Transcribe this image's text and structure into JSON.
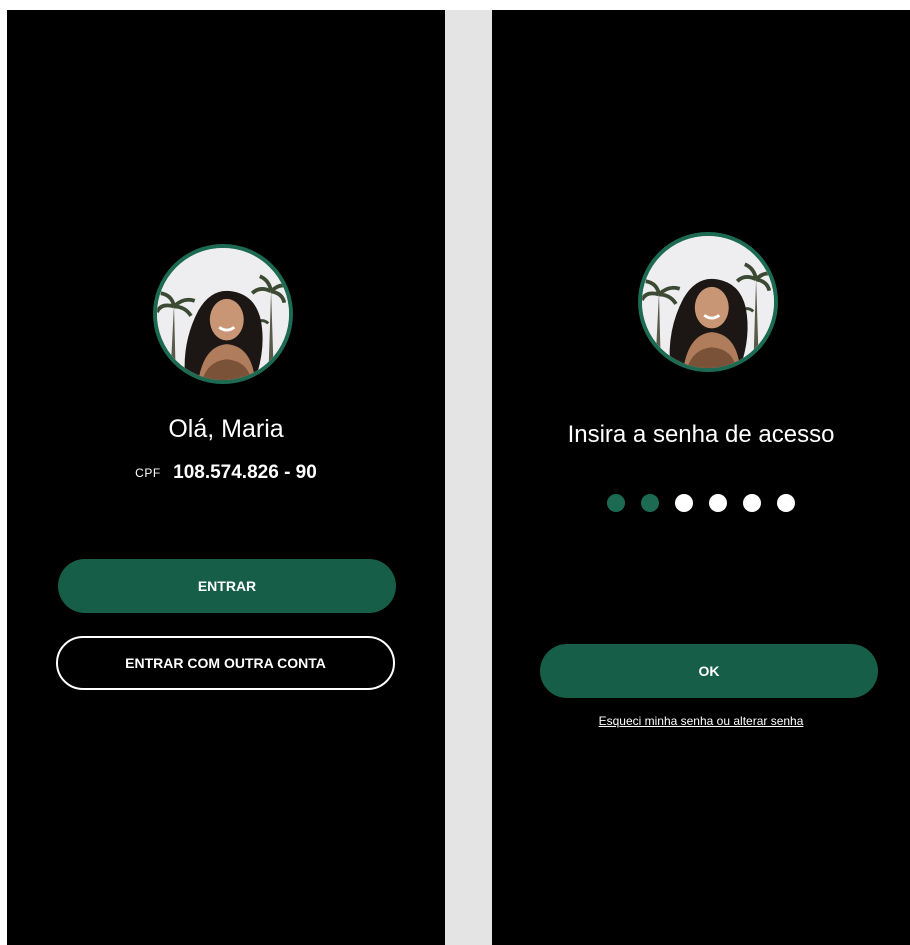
{
  "login_screen": {
    "avatar": "profile-photo",
    "greeting": "Olá, Maria",
    "cpf_label": "CPF",
    "cpf_value": "108.574.826 - 90",
    "enter_button": "ENTRAR",
    "other_account_button": "ENTRAR COM OUTRA CONTA"
  },
  "password_screen": {
    "avatar": "profile-photo",
    "prompt": "Insira a senha de acesso",
    "pin_length": 6,
    "pin_filled": 2,
    "ok_button": "OK",
    "forgot_link": "Esqueci minha senha ou alterar senha"
  },
  "colors": {
    "background": "#000000",
    "accent": "#175e48",
    "avatar_ring": "#1d6a52",
    "pin_empty": "#ffffff",
    "text": "#ffffff",
    "divider": "#e4e4e4"
  }
}
